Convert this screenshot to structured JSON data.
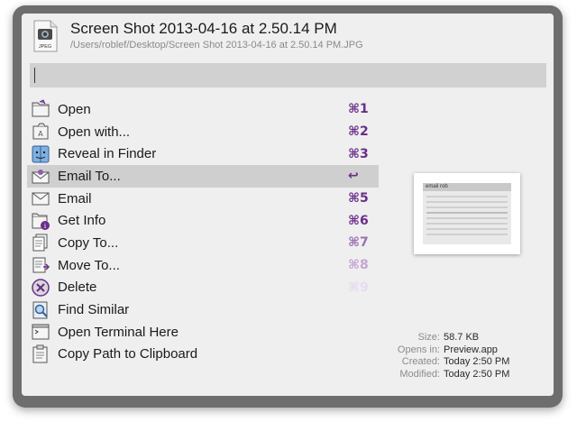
{
  "file": {
    "title": "Screen Shot 2013-04-16 at 2.50.14 PM",
    "path": "/Users/roblef/Desktop/Screen Shot 2013-04-16 at 2.50.14 PM.JPG",
    "icon_label": "JPEG"
  },
  "search": {
    "value": ""
  },
  "actions": [
    {
      "label": "Open",
      "shortcut": "⌘1",
      "icon": "folder-open-icon",
      "key_color": "#6a2e8a"
    },
    {
      "label": "Open with...",
      "shortcut": "⌘2",
      "icon": "open-with-icon",
      "key_color": "#6a2e8a"
    },
    {
      "label": "Reveal in Finder",
      "shortcut": "⌘3",
      "icon": "finder-icon",
      "key_color": "#6a2e8a"
    },
    {
      "label": "Email To...",
      "shortcut": "↩",
      "icon": "email-to-icon",
      "key_color": "#6a2e8a",
      "selected": true
    },
    {
      "label": "Email",
      "shortcut": "⌘5",
      "icon": "envelope-icon",
      "key_color": "#6a2e8a"
    },
    {
      "label": "Get Info",
      "shortcut": "⌘6",
      "icon": "info-icon",
      "key_color": "#6a2e8a"
    },
    {
      "label": "Copy To...",
      "shortcut": "⌘7",
      "icon": "copy-icon",
      "key_color": "#9a6fb3"
    },
    {
      "label": "Move To...",
      "shortcut": "⌘8",
      "icon": "move-icon",
      "key_color": "#c3a6d3"
    },
    {
      "label": "Delete",
      "shortcut": "⌘9",
      "icon": "delete-icon",
      "key_color": "#e6dbee"
    },
    {
      "label": "Find Similar",
      "shortcut": "",
      "icon": "find-similar-icon",
      "key_color": "#6a2e8a"
    },
    {
      "label": "Open Terminal Here",
      "shortcut": "",
      "icon": "terminal-icon",
      "key_color": "#6a2e8a"
    },
    {
      "label": "Copy Path to Clipboard",
      "shortcut": "",
      "icon": "clipboard-icon",
      "key_color": "#6a2e8a"
    }
  ],
  "preview": {
    "title": "email rob"
  },
  "info": {
    "size_label": "Size:",
    "size": "58.7 KB",
    "opens_label": "Opens in:",
    "opens": "Preview.app",
    "created_label": "Created:",
    "created": "Today 2:50 PM",
    "modified_label": "Modified:",
    "modified": "Today 2:50 PM"
  }
}
